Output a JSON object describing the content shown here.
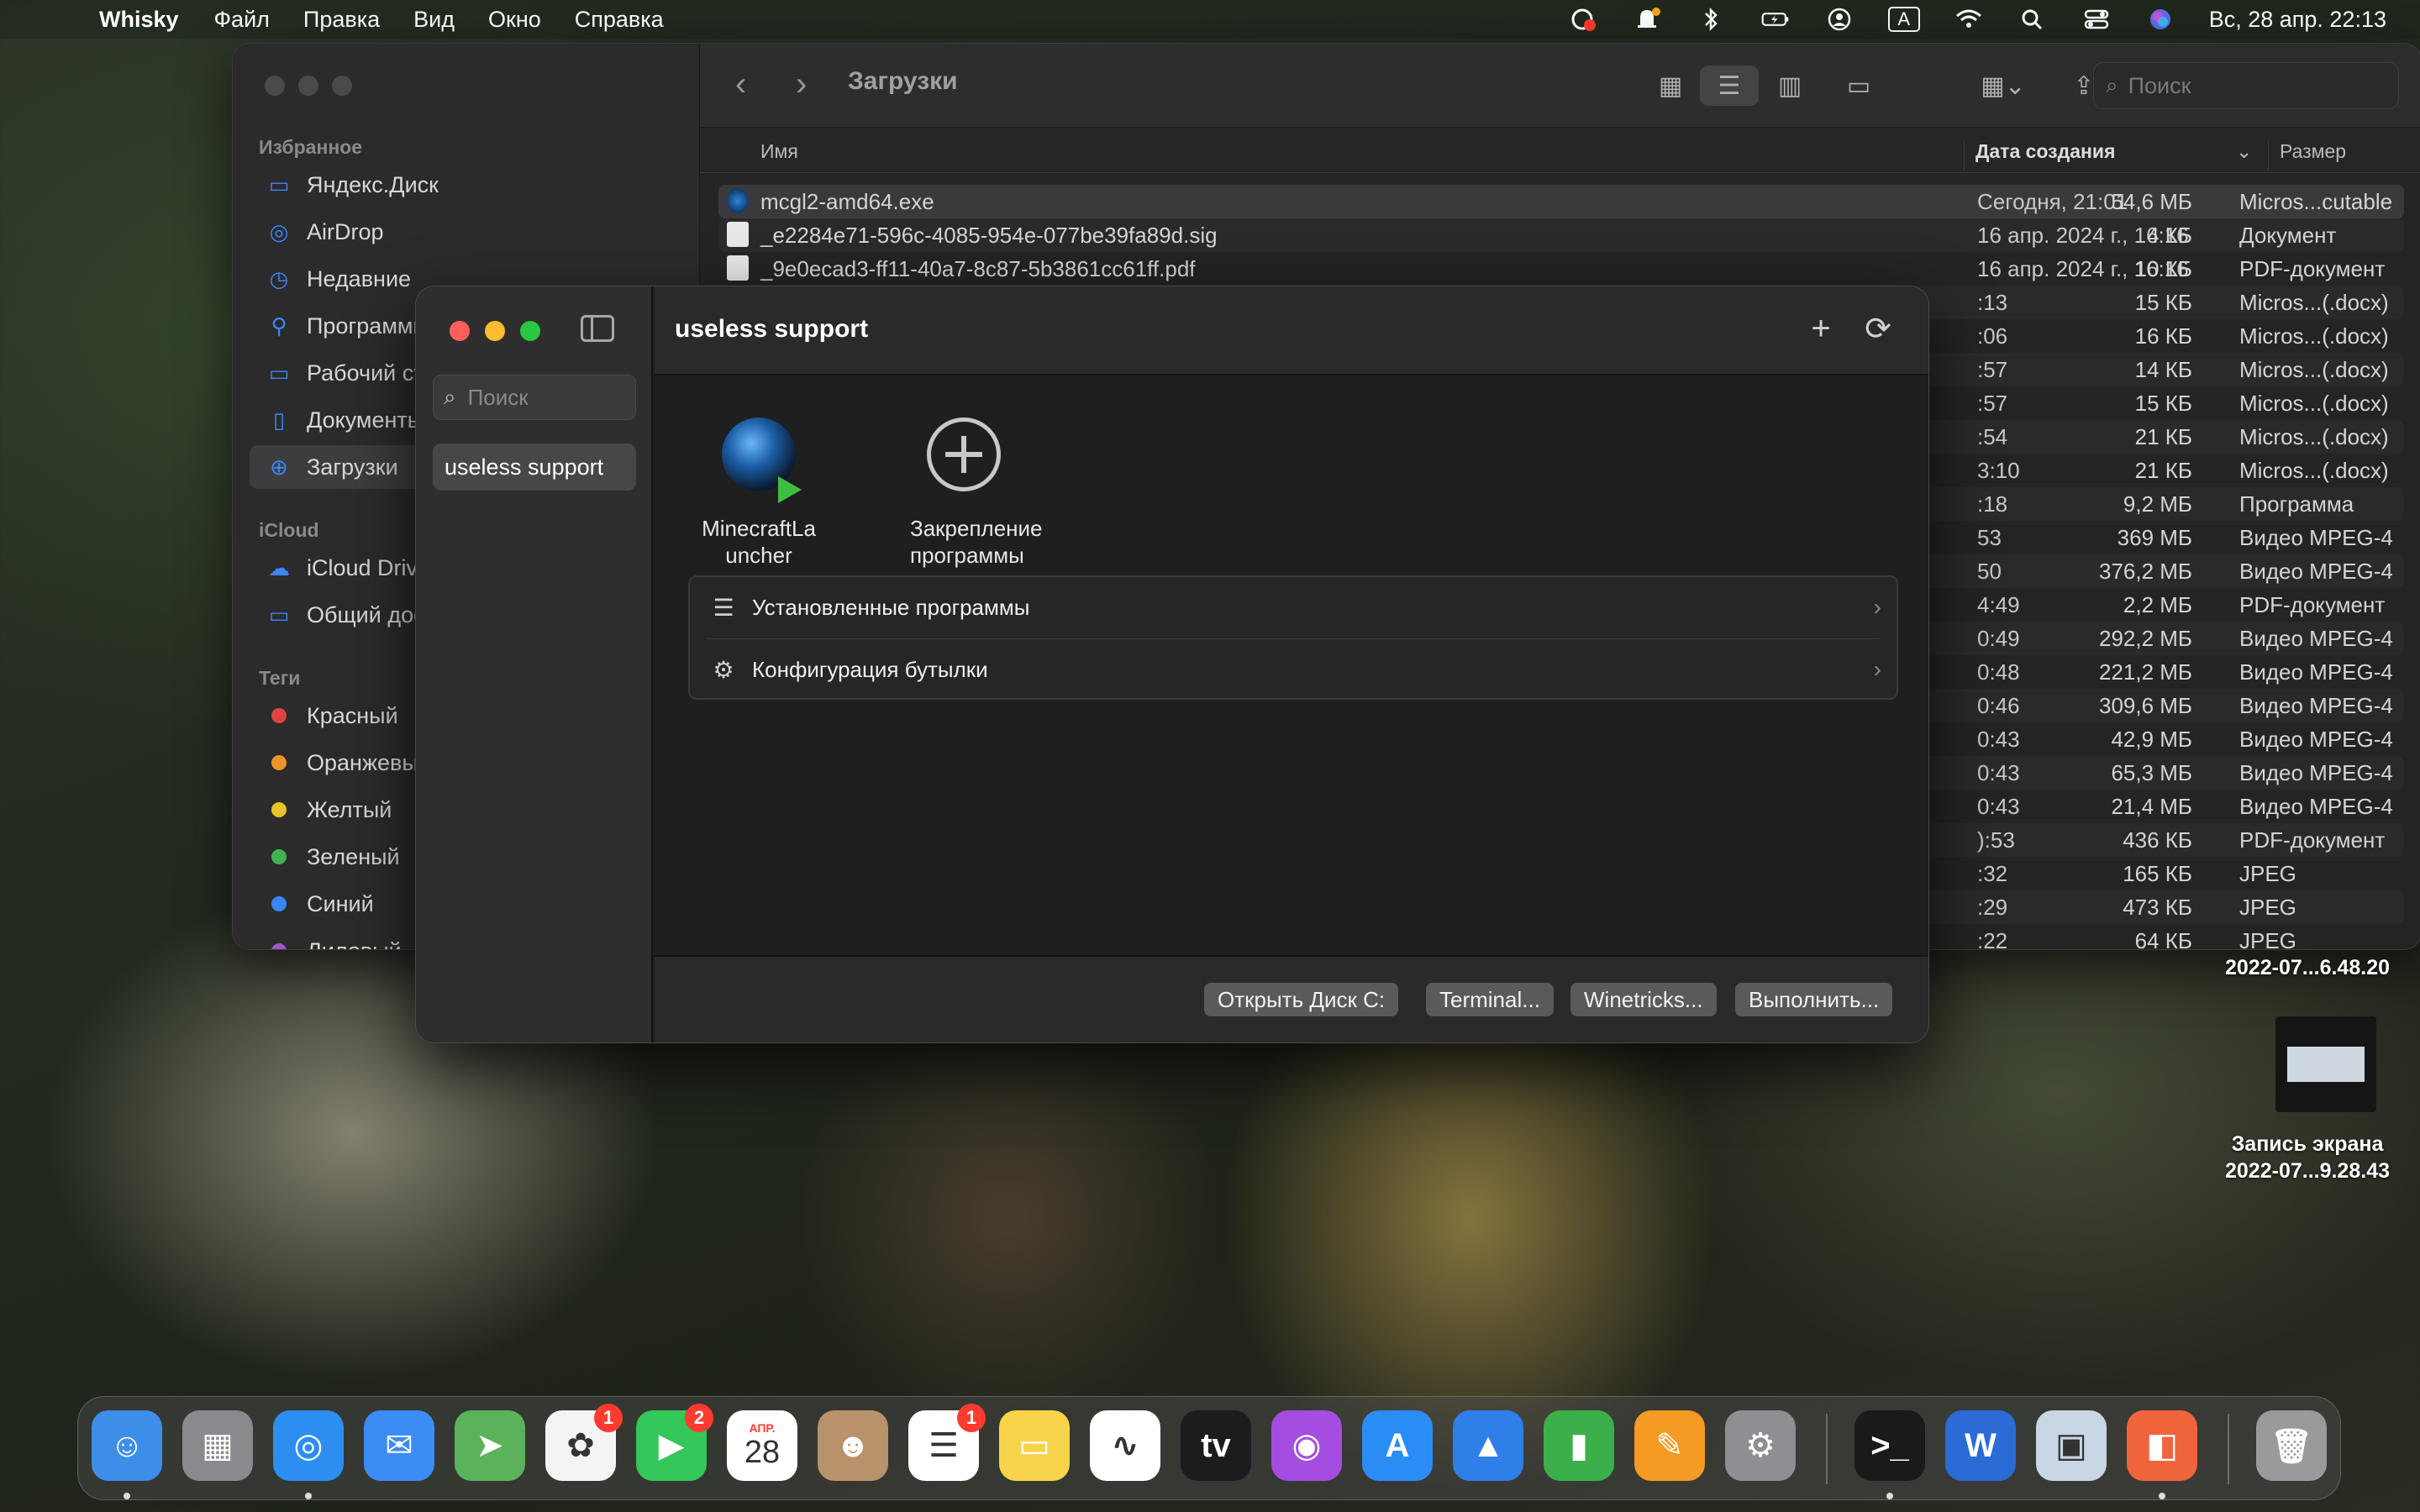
{
  "menubar": {
    "app_name": "Whisky",
    "items": [
      "Файл",
      "Правка",
      "Вид",
      "Окно",
      "Справка"
    ],
    "keyboard_layout": "A",
    "clock": "Вс, 28 апр.  22:13"
  },
  "finder": {
    "title": "Загрузки",
    "search_placeholder": "Поиск",
    "sections": {
      "favorites": "Избранное",
      "icloud": "iCloud",
      "tags": "Теги"
    },
    "favorites": [
      {
        "label": "Яндекс.Диск",
        "icon": "folder-icon"
      },
      {
        "label": "AirDrop",
        "icon": "airdrop-icon"
      },
      {
        "label": "Недавние",
        "icon": "clock-icon"
      },
      {
        "label": "Программы",
        "icon": "apps-icon"
      },
      {
        "label": "Рабочий ст",
        "icon": "desktop-icon"
      },
      {
        "label": "Документь",
        "icon": "document-icon"
      },
      {
        "label": "Загрузки",
        "icon": "download-icon"
      }
    ],
    "icloud_items": [
      {
        "label": "iCloud Drive",
        "icon": "cloud-icon"
      },
      {
        "label": "Общий дос",
        "icon": "shared-folder-icon"
      }
    ],
    "tags": [
      {
        "label": "Красный",
        "color": "#e0443e"
      },
      {
        "label": "Оранжевый",
        "color": "#f0932b"
      },
      {
        "label": "Желтый",
        "color": "#e9c32a"
      },
      {
        "label": "Зеленый",
        "color": "#3fb34f"
      },
      {
        "label": "Синий",
        "color": "#3a86f6"
      },
      {
        "label": "Лиловый",
        "color": "#a056c8"
      }
    ],
    "columns": {
      "name": "Имя",
      "date": "Дата создания",
      "size": "Размер",
      "kind": "Тип"
    },
    "files": [
      {
        "name": "mcgl2-amd64.exe",
        "date": "Сегодня, 21:01",
        "size": "54,6 МБ",
        "kind": "Micros...cutable"
      },
      {
        "name": "_e2284e71-596c-4085-954e-077be39fa89d.sig",
        "date": "16 апр. 2024 г., 16:16",
        "size": "4 КБ",
        "kind": "Документ"
      },
      {
        "name": "_9e0ecad3-ff11-40a7-8c87-5b3861cc61ff.pdf",
        "date": "16 апр. 2024 г., 16:16",
        "size": "10 КБ",
        "kind": "PDF-документ"
      },
      {
        "name": "",
        "date": ":13",
        "size": "15 КБ",
        "kind": "Micros...(.docx)"
      },
      {
        "name": "",
        "date": ":06",
        "size": "16 КБ",
        "kind": "Micros...(.docx)"
      },
      {
        "name": "",
        "date": ":57",
        "size": "14 КБ",
        "kind": "Micros...(.docx)"
      },
      {
        "name": "",
        "date": ":57",
        "size": "15 КБ",
        "kind": "Micros...(.docx)"
      },
      {
        "name": "",
        "date": ":54",
        "size": "21 КБ",
        "kind": "Micros...(.docx)"
      },
      {
        "name": "",
        "date": "3:10",
        "size": "21 КБ",
        "kind": "Micros...(.docx)"
      },
      {
        "name": "",
        "date": ":18",
        "size": "9,2 МБ",
        "kind": "Программа"
      },
      {
        "name": "",
        "date": "53",
        "size": "369 МБ",
        "kind": "Видео MPEG-4"
      },
      {
        "name": "",
        "date": "50",
        "size": "376,2 МБ",
        "kind": "Видео MPEG-4"
      },
      {
        "name": "",
        "date": "4:49",
        "size": "2,2 МБ",
        "kind": "PDF-документ"
      },
      {
        "name": "",
        "date": "0:49",
        "size": "292,2 МБ",
        "kind": "Видео MPEG-4"
      },
      {
        "name": "",
        "date": "0:48",
        "size": "221,2 МБ",
        "kind": "Видео MPEG-4"
      },
      {
        "name": "",
        "date": "0:46",
        "size": "309,6 МБ",
        "kind": "Видео MPEG-4"
      },
      {
        "name": "",
        "date": "0:43",
        "size": "42,9 МБ",
        "kind": "Видео MPEG-4"
      },
      {
        "name": "",
        "date": "0:43",
        "size": "65,3 МБ",
        "kind": "Видео MPEG-4"
      },
      {
        "name": "",
        "date": "0:43",
        "size": "21,4 МБ",
        "kind": "Видео MPEG-4"
      },
      {
        "name": "",
        "date": "):53",
        "size": "436 КБ",
        "kind": "PDF-документ"
      },
      {
        "name": "",
        "date": ":32",
        "size": "165 КБ",
        "kind": "JPEG"
      },
      {
        "name": "",
        "date": ":29",
        "size": "473 КБ",
        "kind": "JPEG"
      },
      {
        "name": "",
        "date": ":22",
        "size": "64 КБ",
        "kind": "JPEG"
      }
    ]
  },
  "whisky": {
    "search_placeholder": "Поиск",
    "bottle_name": "useless support",
    "title": "useless support",
    "programs": [
      {
        "label": "MinecraftLauncher",
        "icon": "minecraft-launcher-icon"
      },
      {
        "label": "Закрепление программы",
        "icon": "add-circle-icon"
      }
    ],
    "list": [
      {
        "label": "Установленные программы",
        "icon": "list-icon"
      },
      {
        "label": "Конфигурация бутылки",
        "icon": "gear-icon"
      }
    ],
    "footer_buttons": {
      "open_c": "Открыть Диск C:",
      "terminal": "Terminal...",
      "winetricks": "Winetricks...",
      "run": "Выполнить..."
    }
  },
  "desktop": {
    "item1_label": "2022-07...6.48.20",
    "item2_label_line1": "Запись экрана",
    "item2_label_line2": "2022-07...9.28.43"
  },
  "dock": {
    "apps": [
      {
        "name": "finder-icon",
        "color": "#3d8ee8",
        "glyph": "☺"
      },
      {
        "name": "launchpad-icon",
        "color": "#8a8a8e",
        "glyph": "▦"
      },
      {
        "name": "safari-icon",
        "color": "#2c8ef0",
        "glyph": "◎"
      },
      {
        "name": "mail-icon",
        "color": "#3b8cf5",
        "glyph": "✉"
      },
      {
        "name": "maps-icon",
        "color": "#5bb25b",
        "glyph": "➤"
      },
      {
        "name": "photos-icon",
        "color": "#f4f4f4",
        "glyph": "✿",
        "badge": "1"
      },
      {
        "name": "facetime-icon",
        "color": "#34c759",
        "glyph": "▶",
        "badge": "2"
      },
      {
        "name": "calendar-icon",
        "color": "#ffffff",
        "glyph": "28",
        "month": "АПР."
      },
      {
        "name": "contacts-icon",
        "color": "#b8926a",
        "glyph": "☻"
      },
      {
        "name": "reminders-icon",
        "color": "#ffffff",
        "glyph": "☰",
        "badge": "1"
      },
      {
        "name": "notes-icon",
        "color": "#f7d44a",
        "glyph": "▭"
      },
      {
        "name": "freeform-icon",
        "color": "#ffffff",
        "glyph": "∿"
      },
      {
        "name": "appletv-icon",
        "color": "#1c1c1e",
        "glyph": "tv"
      },
      {
        "name": "podcasts-icon",
        "color": "#a44de0",
        "glyph": "◉"
      },
      {
        "name": "appstore-icon",
        "color": "#2a8df5",
        "glyph": "A"
      },
      {
        "name": "keynote-icon",
        "color": "#2f7fe8",
        "glyph": "▲"
      },
      {
        "name": "numbers-icon",
        "color": "#3bb04a",
        "glyph": "▮"
      },
      {
        "name": "pages-icon",
        "color": "#f59a23",
        "glyph": "✎"
      },
      {
        "name": "system-settings-icon",
        "color": "#8e8e93",
        "glyph": "⚙"
      },
      {
        "name": "terminal-icon",
        "color": "#1a1a1a",
        "glyph": ">_"
      },
      {
        "name": "word-icon",
        "color": "#2b6bd6",
        "glyph": "W"
      },
      {
        "name": "preview-icon",
        "color": "#c9d6e3",
        "glyph": "▣"
      },
      {
        "name": "whisky-icon",
        "color": "#f0643c",
        "glyph": "◧"
      },
      {
        "name": "trash-icon",
        "color": "#9a9a9c",
        "glyph": "🗑"
      }
    ]
  }
}
